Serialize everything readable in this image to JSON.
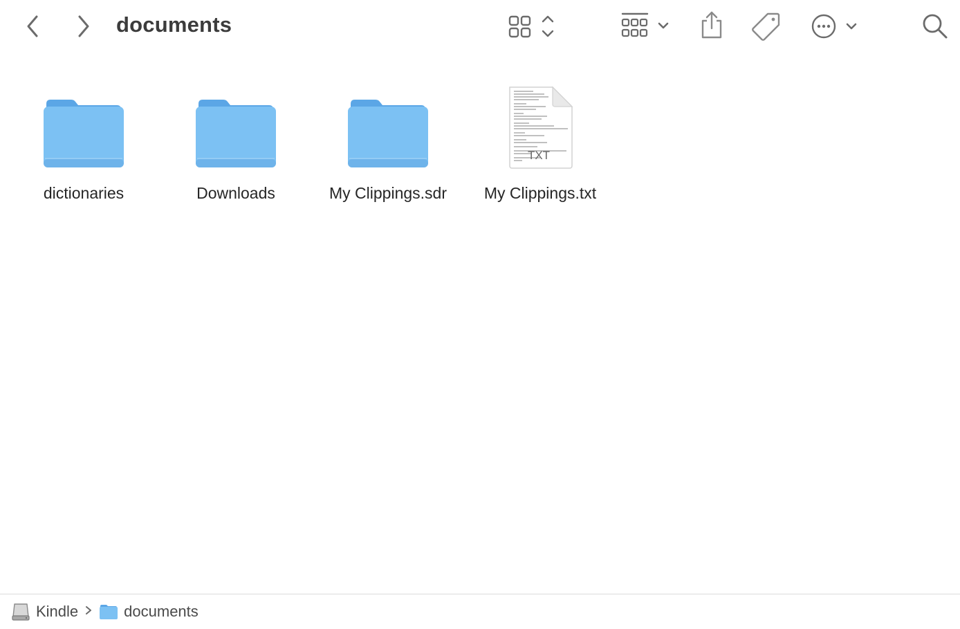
{
  "window": {
    "title": "documents"
  },
  "toolbar": {
    "back_icon": "chevron-left-icon",
    "forward_icon": "chevron-right-icon",
    "view_icon": "icon-grid-view-icon",
    "group_icon": "group-by-icon",
    "share_icon": "share-icon",
    "tag_icon": "tag-icon",
    "action_icon": "ellipsis-circle-icon",
    "search_icon": "search-icon"
  },
  "files": [
    {
      "name": "dictionaries",
      "kind": "folder"
    },
    {
      "name": "Downloads",
      "kind": "folder"
    },
    {
      "name": "My Clippings.sdr",
      "kind": "folder"
    },
    {
      "name": "My Clippings.txt",
      "kind": "text-document",
      "badge": "TXT"
    }
  ],
  "pathbar": {
    "items": [
      {
        "label": "Kindle",
        "icon": "drive-icon"
      },
      {
        "label": "documents",
        "icon": "folder-icon"
      }
    ]
  },
  "colors": {
    "folder": "#7cc1f3",
    "folder_tab": "#5ba6e6",
    "icon_gray": "#7a7a7a"
  }
}
